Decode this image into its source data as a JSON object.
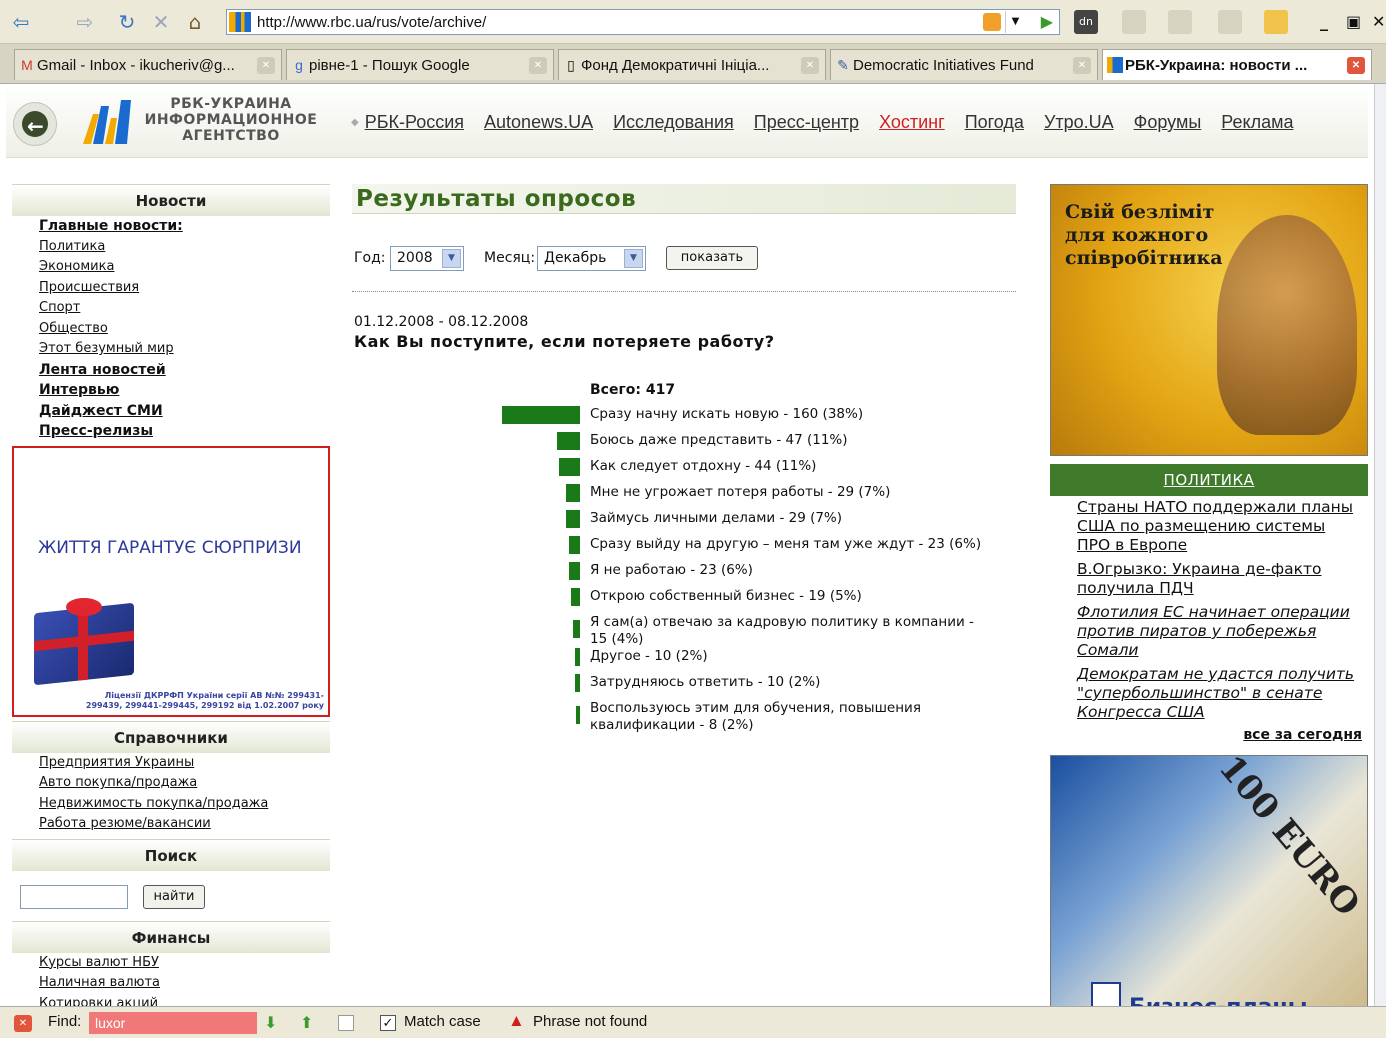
{
  "browser": {
    "url": "http://www.rbc.ua/rus/vote/archive/",
    "tabs": [
      {
        "label": "Gmail - Inbox - ikucheriv@g...",
        "icon": "gmail-icon"
      },
      {
        "label": "рівне-1 - Пошук Google",
        "icon": "google-icon"
      },
      {
        "label": "Фонд Демократичні Ініціа...",
        "icon": "page-icon"
      },
      {
        "label": "Democratic Initiatives Fund",
        "icon": "link-icon"
      },
      {
        "label": "РБК-Украина: новости ...",
        "icon": "rbc-icon"
      }
    ],
    "toolbar_dn": "dn",
    "find": {
      "label": "Find:",
      "value": "luxor",
      "match_case": "Match case",
      "status": "Phrase not found"
    }
  },
  "header": {
    "logo_lines": [
      "РБК-УКРАИНА",
      "ИНФОРМАЦИОННОЕ",
      "АГЕНТСТВО"
    ],
    "nav": [
      "РБК-Россия",
      "Autonews.UA",
      "Исследования",
      "Пресс-центр",
      "Хостинг",
      "Погода",
      "Утро.UA",
      "Форумы",
      "Реклама"
    ],
    "accent_color": "#d01f1f"
  },
  "sidebar": {
    "news_title": "Новости",
    "news_links": [
      {
        "label": "Главные новости:",
        "bold": true
      },
      {
        "label": "Политика",
        "bold": false
      },
      {
        "label": "Экономика",
        "bold": false
      },
      {
        "label": "Происшествия",
        "bold": false
      },
      {
        "label": "Спорт",
        "bold": false
      },
      {
        "label": "Общество",
        "bold": false
      },
      {
        "label": "Этот безумный мир",
        "bold": false
      },
      {
        "label": "Лента новостей",
        "bold": true
      },
      {
        "label": "Интервью",
        "bold": true
      },
      {
        "label": "Дайджест СМИ",
        "bold": true
      },
      {
        "label": "Пресс-релизы",
        "bold": true
      }
    ],
    "promo": {
      "headline": "ЖИТТЯ ГАРАНТУЄ СЮРПРИЗИ",
      "fine_print": "Ліцензії ДКРРФП України серії АВ №№ 299431-299439, 299441-299445, 299192 від 1.02.2007 року"
    },
    "ref_title": "Справочники",
    "ref_links": [
      "Предприятия Украины",
      "Авто покупка/продажа",
      "Недвижимость покупка/продажа",
      "Работа резюме/вакансии"
    ],
    "search_title": "Поиск",
    "search_button": "найти",
    "finance_title": "Финансы",
    "finance_links": [
      "Курсы валют НБУ",
      "Наличная валюта",
      "Котировки акций"
    ]
  },
  "main": {
    "title": "Результаты опросов",
    "year_label": "Год:",
    "year_value": "2008",
    "month_label": "Месяц:",
    "month_value": "Декабрь",
    "show_button": "показать",
    "poll_dates": "01.12.2008 - 08.12.2008",
    "poll_question": "Как Вы поступите, если потеряете работу?",
    "poll_total": "Всего: 417",
    "bar_color": "#1a7a1a"
  },
  "chart_data": {
    "type": "bar",
    "orientation": "horizontal",
    "total": 417,
    "categories": [
      "Сразу начну искать новую - 160 (38%)",
      "Боюсь даже представить - 47 (11%)",
      "Как следует отдохну - 44 (11%)",
      "Мне не угрожает потеря работы - 29 (7%)",
      "Займусь личными делами - 29 (7%)",
      "Сразу выйду на другую – меня там уже ждут - 23 (6%)",
      "Я не работаю - 23 (6%)",
      "Открою собственный бизнес - 19 (5%)",
      "Я сам(а) отвечаю за кадровую политику в компании - 15 (4%)",
      "Другое - 10 (2%)",
      "Затрудняюсь ответить - 10 (2%)",
      "Воспользуюсь этим для обучения, повышения квалификации - 8 (2%)"
    ],
    "values": [
      160,
      47,
      44,
      29,
      29,
      23,
      23,
      19,
      15,
      10,
      10,
      8
    ]
  },
  "right": {
    "ad_top_text": "Свій безліміт для кожного співробітника",
    "news_title": "ПОЛИТИКА",
    "news": [
      {
        "label": "Страны НАТО поддержали планы США по размещению системы ПРО в Европе",
        "italic": false
      },
      {
        "label": "В.Огрызко: Украина де-факто получила ПДЧ",
        "italic": false
      },
      {
        "label": "Флотилия ЕС начинает операции против пиратов у побережья Сомали",
        "italic": true
      },
      {
        "label": "Демократам не удастся получить \"супербольшинство\" в сенате Конгресса США",
        "italic": true
      }
    ],
    "all_today": "все за сегодня",
    "ad_bottom_note": "100 EURO",
    "ad_bottom_brand": "Бизнес-планы"
  }
}
